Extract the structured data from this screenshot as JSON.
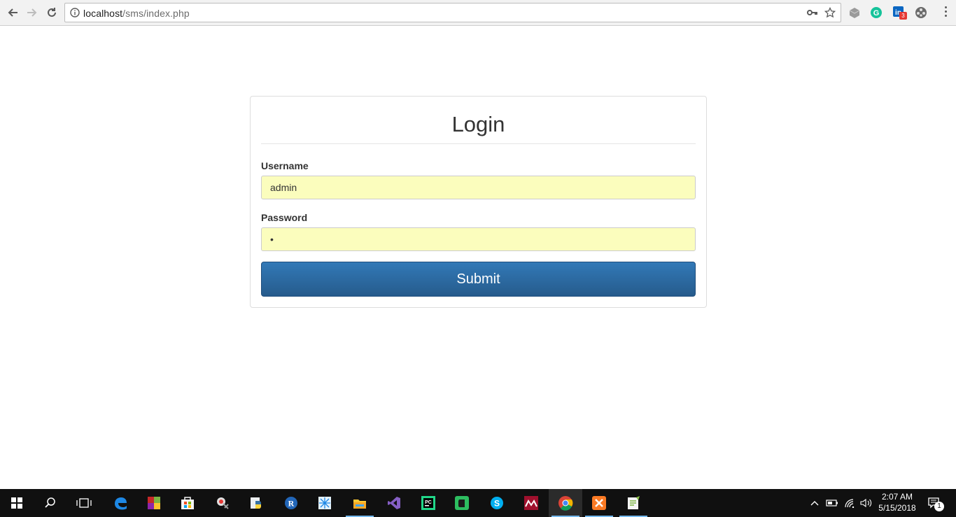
{
  "browser": {
    "url_host": "localhost",
    "url_path": "/sms/index.php",
    "linkedin_badge": "3"
  },
  "login": {
    "title": "Login",
    "username_label": "Username",
    "username_value": "admin",
    "password_label": "Password",
    "password_value": "•",
    "submit_label": "Submit"
  },
  "taskbar": {
    "apps": [
      "start-icon",
      "search-icon",
      "task-view-icon",
      "edge-icon",
      "winrar-icon",
      "store-icon",
      "snipping-icon",
      "python-icon",
      "r-icon",
      "tracker-icon",
      "file-explorer-icon",
      "visual-studio-icon",
      "pycharm-icon",
      "evernote-icon",
      "skype-icon",
      "mendeley-icon",
      "chrome-icon",
      "xampp-icon",
      "notepadpp-icon"
    ],
    "time": "2:07 AM",
    "date": "5/15/2018",
    "notification_count": "1"
  }
}
